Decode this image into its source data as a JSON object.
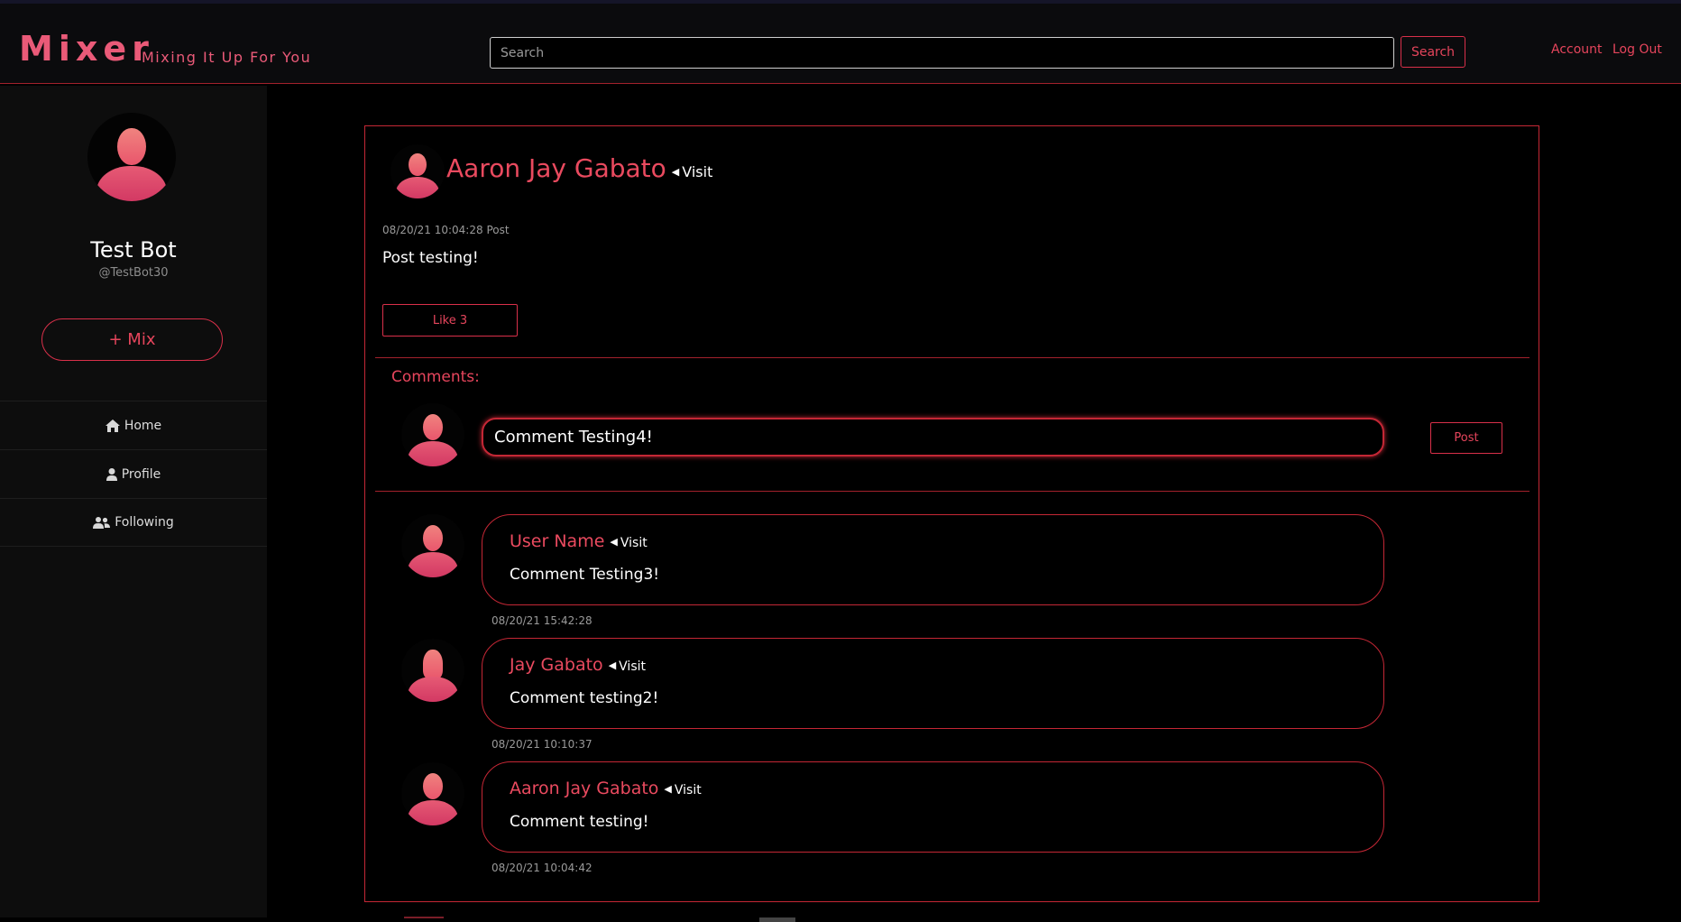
{
  "header": {
    "brand": "Mixer",
    "tagline": "Mixing It Up For You",
    "search_placeholder": "Search",
    "search_button": "Search",
    "account_link": "Account",
    "logout_link": "Log Out"
  },
  "sidebar": {
    "profile_name": "Test Bot",
    "profile_handle": "@TestBot30",
    "mix_button": "+ Mix",
    "nav": [
      {
        "label": "Home",
        "icon": "home-icon"
      },
      {
        "label": "Profile",
        "icon": "user-icon"
      },
      {
        "label": "Following",
        "icon": "users-icon"
      }
    ]
  },
  "post": {
    "author": "Aaron Jay Gabato",
    "visit_label": "Visit",
    "timestamp": "08/20/21 10:04:28",
    "type_label": "Post",
    "body": "Post testing!",
    "like_label": "Like 3",
    "comments_title": "Comments:",
    "comment_input_value": "Comment Testing4!",
    "post_button": "Post",
    "comments": [
      {
        "name": "User Name",
        "visit": "Visit",
        "text": "Comment Testing3!",
        "time": "08/20/21 15:42:28",
        "avatar": "male"
      },
      {
        "name": "Jay Gabato",
        "visit": "Visit",
        "text": "Comment testing2!",
        "time": "08/20/21 10:10:37",
        "avatar": "female"
      },
      {
        "name": "Aaron Jay Gabato",
        "visit": "Visit",
        "text": "Comment testing!",
        "time": "08/20/21 10:04:42",
        "avatar": "male"
      }
    ]
  },
  "colors": {
    "accent": "#e6455c",
    "border": "#c42735",
    "background": "#000000",
    "sidebar": "#0d0d0d"
  }
}
